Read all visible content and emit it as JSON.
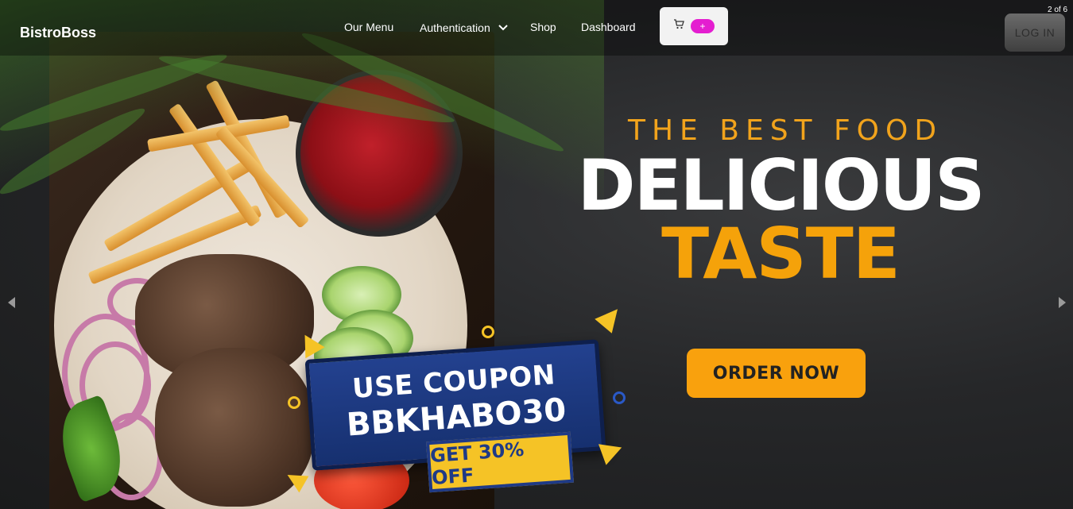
{
  "navbar": {
    "brand": "BistroBoss",
    "links": [
      "Our Menu",
      "Authentication",
      "Shop",
      "Dashboard"
    ],
    "cart_badge": "+",
    "login_label": "LOG IN"
  },
  "carousel": {
    "slide_counter": "2 of 6"
  },
  "hero": {
    "eyebrow": "THE BEST FOOD",
    "headline_1": "DELICIOUS",
    "headline_2": "TASTE",
    "cta_label": "ORDER NOW",
    "coupon_line_1": "USE COUPON",
    "coupon_code": "BBKHABO30",
    "offer": "GET 30% OFF"
  },
  "colors": {
    "accent": "#f9a10d",
    "cart_badge": "#e41ed0",
    "coupon_blue": "#23418f",
    "offer_yellow": "#f5c326"
  },
  "icons": {
    "cart": "cart-icon",
    "chevron": "chevron-down-icon",
    "prev": "arrow-left-icon",
    "next": "arrow-right-icon"
  }
}
